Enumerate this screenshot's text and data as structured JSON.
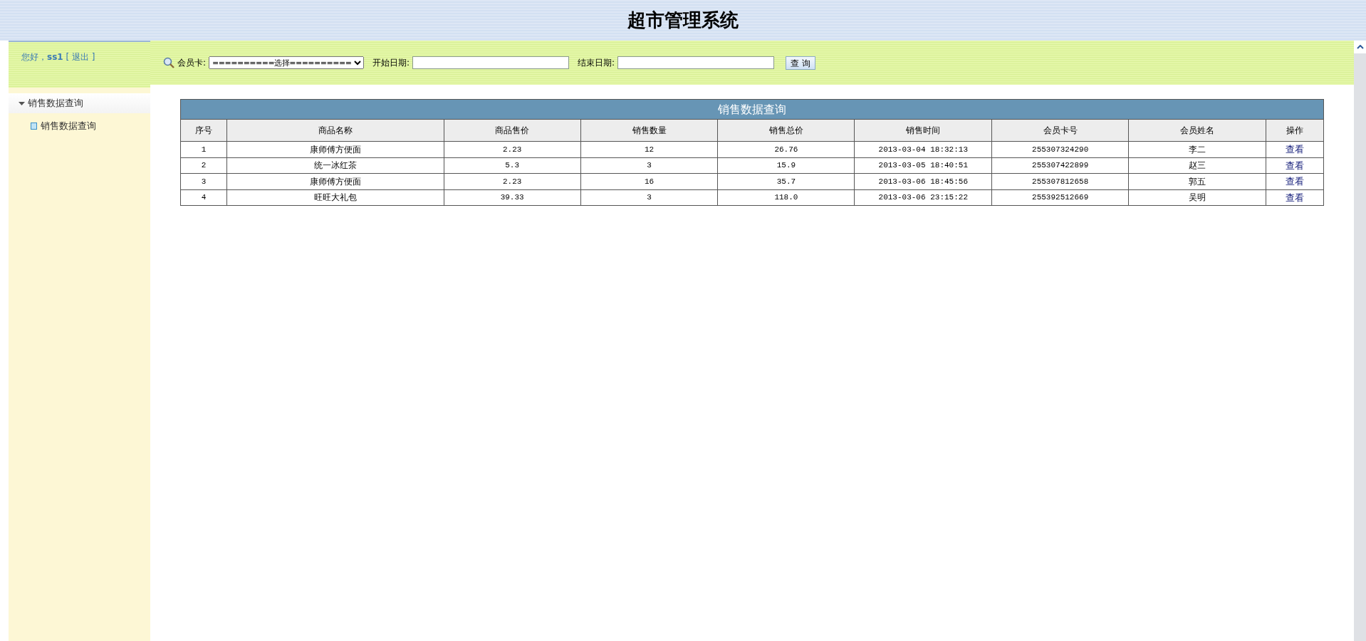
{
  "header": {
    "title": "超市管理系统"
  },
  "user_panel": {
    "greeting": "您好，",
    "username": "ss1",
    "bracket_open": "[",
    "logout": "退出",
    "bracket_close": "]"
  },
  "sidebar": {
    "items": [
      {
        "label": "销售数据查询",
        "expanded": true,
        "children": [
          {
            "label": "销售数据查询",
            "selected": false
          }
        ]
      }
    ]
  },
  "filter_bar": {
    "member_card_label": "会员卡:",
    "member_card_select": "==========选择==========",
    "start_date_label": "开始日期:",
    "end_date_label": "结束日期:",
    "query_button": "查 询"
  },
  "table": {
    "title": "销售数据查询",
    "columns": [
      "序号",
      "商品名称",
      "商品售价",
      "销售数量",
      "销售总价",
      "销售时间",
      "会员卡号",
      "会员姓名",
      "操作"
    ],
    "rows": [
      [
        "1",
        "康师傅方便面",
        "2.23",
        "12",
        "26.76",
        "2013-03-04 18:32:13",
        "255307324290",
        "李二",
        "查看"
      ],
      [
        "2",
        "统一冰红茶",
        "5.3",
        "3",
        "15.9",
        "2013-03-05 18:40:51",
        "255307422899",
        "赵三",
        "查看"
      ],
      [
        "3",
        "康师傅方便面",
        "2.23",
        "16",
        "35.7",
        "2013-03-06 18:45:56",
        "255307812658",
        "郭五",
        "查看"
      ],
      [
        "4",
        "旺旺大礼包",
        "39.33",
        "3",
        "118.0",
        "2013-03-06 23:15:22",
        "255392512669",
        "吴明",
        "查看"
      ]
    ]
  }
}
